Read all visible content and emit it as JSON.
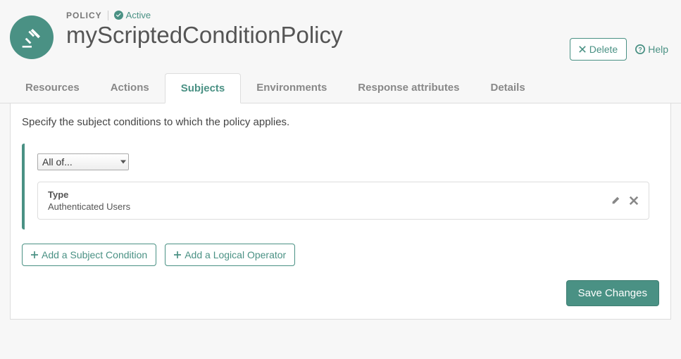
{
  "header": {
    "policy_label": "POLICY",
    "status": "Active",
    "title": "myScriptedConditionPolicy",
    "delete_label": "Delete",
    "help_label": "Help"
  },
  "tabs": {
    "resources": "Resources",
    "actions": "Actions",
    "subjects": "Subjects",
    "environments": "Environments",
    "response_attributes": "Response attributes",
    "details": "Details",
    "active": "subjects"
  },
  "panel": {
    "description": "Specify the subject conditions to which the policy applies.",
    "logical_select": "All of...",
    "condition": {
      "type_label": "Type",
      "type_value": "Authenticated Users"
    },
    "add_subject_label": "Add a Subject Condition",
    "add_operator_label": "Add a Logical Operator",
    "save_label": "Save Changes"
  }
}
